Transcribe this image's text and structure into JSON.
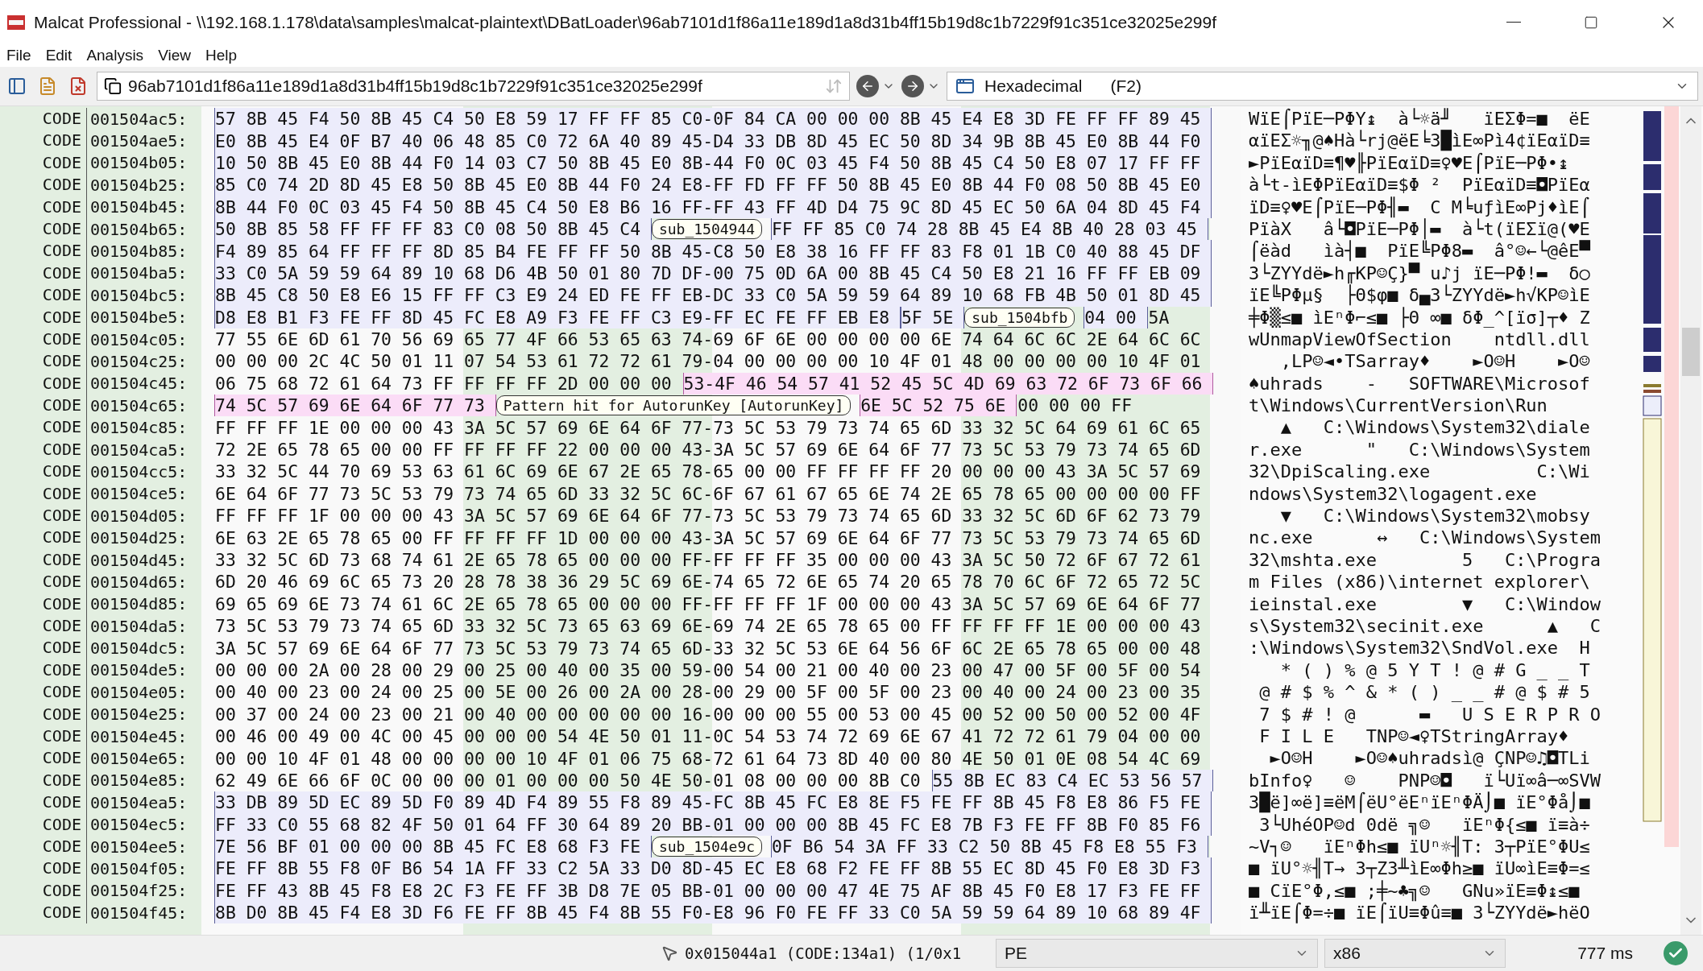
{
  "window": {
    "title": "Malcat Professional - \\\\192.168.1.178\\data\\samples\\malcat-plaintext\\DBatLoader\\96ab7101d1f86a11e189d1a8d31b4ff15b19d8c1b7229f91c351ce32025e299f"
  },
  "menu": [
    "File",
    "Edit",
    "Analysis",
    "View",
    "Help"
  ],
  "toolbar": {
    "path": "96ab7101d1f86a11e189d1a8d31b4ff15b19d8c1b7229f91c351ce32025e299f",
    "view_mode": {
      "label": "Hexadecimal",
      "shortcut": "(F2)"
    }
  },
  "hex_view": {
    "rows": [
      {
        "segment": "CODE",
        "address": "001504ac5:",
        "spans": [
          {
            "kind": "function",
            "text": "57 8B 45 F4 50 8B 45 C4 50 E8 59 17 FF FF 85 C0-0F 84 CA 00 00 00 8B 45 E4 E8 3D FE FF FF 89 45"
          }
        ],
        "ascii": "WïE⌠PïE─PΦY↨  à└☼ä╜   ïEΣΦ=■  ëE"
      },
      {
        "segment": "CODE",
        "address": "001504ae5:",
        "spans": [
          {
            "kind": "function",
            "text": "E0 8B 45 E4 0F B7 40 06 48 85 C0 72 6A 40 89 45-D4 33 DB 8D 45 EC 50 8D 34 9B 8B 45 E0 8B 44 F0"
          }
        ],
        "ascii": "αïEΣ☼╖@♠Hà└rj@ëE╘3█ìE∞Pì4¢ïEαïD≡"
      },
      {
        "segment": "CODE",
        "address": "001504b05:",
        "spans": [
          {
            "kind": "function",
            "text": "10 50 8B 45 E0 8B 44 F0 14 03 C7 50 8B 45 E0 8B-44 F0 0C 03 45 F4 50 8B 45 C4 50 E8 07 17 FF FF"
          }
        ],
        "ascii": "►PïEαïD≡¶♥╟PïEαïD≡♀♥E⌠PïE─PΦ•↨  "
      },
      {
        "segment": "CODE",
        "address": "001504b25:",
        "spans": [
          {
            "kind": "function",
            "text": "85 C0 74 2D 8D 45 E8 50 8B 45 E0 8B 44 F0 24 E8-FF FD FF FF 50 8B 45 E0 8B 44 F0 08 50 8B 45 E0"
          }
        ],
        "ascii": "à└t-ìEΦPïEαïD≡$Φ ²  PïEαïD≡◘PïEα"
      },
      {
        "segment": "CODE",
        "address": "001504b45:",
        "spans": [
          {
            "kind": "function",
            "text": "8B 44 F0 0C 03 45 F4 50 8B 45 C4 50 E8 B6 16 FF-FF 43 FF 4D D4 75 9C 8D 45 EC 50 6A 04 8D 45 F4"
          }
        ],
        "ascii": "ïD≡♀♥E⌠PïE─PΦ╢▬  C M╘uƒìE∞Pj♦ìE⌠"
      },
      {
        "segment": "CODE",
        "address": "001504b65:",
        "spans": [
          {
            "kind": "function",
            "text": "50 8B 85 58 FF FF FF 83 C0 08 50 8B 45 C4"
          },
          {
            "kind": "label",
            "text": "sub_1504944"
          },
          {
            "kind": "function",
            "text": "FF FF 85 C0 74 28 8B 45 E4 8B 40 28 03 45"
          }
        ],
        "ascii": "PïàX   â└◘PïE─PΦ│▬  à└t(ïEΣï@(♥E"
      },
      {
        "segment": "CODE",
        "address": "001504b85:",
        "spans": [
          {
            "kind": "function",
            "text": "F4 89 85 64 FF FF FF 8D 85 B4 FE FF FF 50 8B 45-C8 50 E8 38 16 FF FF 83 F8 01 1B C0 40 88 45 DF"
          }
        ],
        "ascii": "⌠ëàd   ìà┤■  PïE╚PΦ8▬  â°☺←└@êE▀"
      },
      {
        "segment": "CODE",
        "address": "001504ba5:",
        "spans": [
          {
            "kind": "function",
            "text": "33 C0 5A 59 59 64 89 10 68 D6 4B 50 01 80 7D DF-00 75 0D 6A 00 8B 45 C4 50 E8 21 16 FF FF EB 09"
          }
        ],
        "ascii": "3└ZYYdë►h╓KP☺Ç}▀ u♪j ïE─PΦ!▬  δ○"
      },
      {
        "segment": "CODE",
        "address": "001504bc5:",
        "spans": [
          {
            "kind": "function",
            "text": "8B 45 C8 50 E8 E6 15 FF FF C3 E9 24 ED FE FF EB-DC 33 C0 5A 59 59 64 89 10 68 FB 4B 50 01 8D 45"
          }
        ],
        "ascii": "ïE╚PΦµ§  ├Θ$φ■ δ▄3└ZYYdë►h√KP☺ìE"
      },
      {
        "segment": "CODE",
        "address": "001504be5:",
        "spans": [
          {
            "kind": "function",
            "text": "D8 E8 B1 F3 FE FF 8D 45 FC E8 A9 F3 FE FF C3 E9-FF EC FE FF EB E8"
          },
          {
            "kind": "function",
            "text": "5F 5E"
          },
          {
            "kind": "label",
            "text": "sub_1504bfb"
          },
          {
            "kind": "function",
            "text": "04 00"
          },
          {
            "kind": "plain",
            "text": "5A"
          }
        ],
        "ascii": "╪Φ▒≤■ ìEⁿΦ⌐≤■ ├Θ ∞■ δΦ_^[ïσ]┬♦ Z"
      },
      {
        "segment": "CODE",
        "address": "001504c05:",
        "spans": [
          {
            "kind": "plain",
            "text": "77 55 6E 6D 61 70 56 69 65 77 4F 66 53 65 63 74-69 6F 6E 00 00 00 00 6E 74 64 6C 6C 2E 64 6C 6C"
          }
        ],
        "ascii": "wUnmapViewOfSection    ntdll.dll"
      },
      {
        "segment": "CODE",
        "address": "001504c25:",
        "spans": [
          {
            "kind": "plain",
            "text": "00 00 00 2C 4C 50 01 11 07 54 53 61 72 72 61 79-04 00 00 00 00 10 4F 01 48 00 00 00 00 10 4F 01"
          }
        ],
        "ascii": "   ,LP☺◄•TSarray♦    ►O☺H    ►O☺"
      },
      {
        "segment": "CODE",
        "address": "001504c45:",
        "spans": [
          {
            "kind": "plain",
            "text": "06 75 68 72 61 64 73 FF FF FF FF 2D 00 00 00"
          },
          {
            "kind": "pattern",
            "text": "53-4F 46 54 57 41 52 45 5C 4D 69 63 72 6F 73 6F 66"
          }
        ],
        "ascii": "♠uhrads    -   SOFTWARE\\Microsof"
      },
      {
        "segment": "CODE",
        "address": "001504c65:",
        "spans": [
          {
            "kind": "pattern",
            "text": "74 5C 57 69 6E 64 6F 77 73"
          },
          {
            "kind": "label",
            "text": "Pattern hit for AutorunKey [AutorunKey]"
          },
          {
            "kind": "pattern",
            "text": "6E 5C 52 75 6E"
          },
          {
            "kind": "plain",
            "text": "00 00 00 FF"
          }
        ],
        "ascii": "t\\Windows\\CurrentVersion\\Run"
      },
      {
        "segment": "CODE",
        "address": "001504c85:",
        "spans": [
          {
            "kind": "plain",
            "text": "FF FF FF 1E 00 00 00 43 3A 5C 57 69 6E 64 6F 77-73 5C 53 79 73 74 65 6D 33 32 5C 64 69 61 6C 65"
          }
        ],
        "ascii": "   ▲   C:\\Windows\\System32\\diale"
      },
      {
        "segment": "CODE",
        "address": "001504ca5:",
        "spans": [
          {
            "kind": "plain",
            "text": "72 2E 65 78 65 00 00 FF FF FF FF 22 00 00 00 43-3A 5C 57 69 6E 64 6F 77 73 5C 53 79 73 74 65 6D"
          }
        ],
        "ascii": "r.exe      \"   C:\\Windows\\System"
      },
      {
        "segment": "CODE",
        "address": "001504cc5:",
        "spans": [
          {
            "kind": "plain",
            "text": "33 32 5C 44 70 69 53 63 61 6C 69 6E 67 2E 65 78-65 00 00 FF FF FF FF 20 00 00 00 43 3A 5C 57 69"
          }
        ],
        "ascii": "32\\DpiScaling.exe          C:\\Wi"
      },
      {
        "segment": "CODE",
        "address": "001504ce5:",
        "spans": [
          {
            "kind": "plain",
            "text": "6E 64 6F 77 73 5C 53 79 73 74 65 6D 33 32 5C 6C-6F 67 61 67 65 6E 74 2E 65 78 65 00 00 00 00 FF"
          }
        ],
        "ascii": "ndows\\System32\\logagent.exe"
      },
      {
        "segment": "CODE",
        "address": "001504d05:",
        "spans": [
          {
            "kind": "plain",
            "text": "FF FF FF 1F 00 00 00 43 3A 5C 57 69 6E 64 6F 77-73 5C 53 79 73 74 65 6D 33 32 5C 6D 6F 62 73 79"
          }
        ],
        "ascii": "   ▼   C:\\Windows\\System32\\mobsy"
      },
      {
        "segment": "CODE",
        "address": "001504d25:",
        "spans": [
          {
            "kind": "plain",
            "text": "6E 63 2E 65 78 65 00 FF FF FF FF 1D 00 00 00 43-3A 5C 57 69 6E 64 6F 77 73 5C 53 79 73 74 65 6D"
          }
        ],
        "ascii": "nc.exe      ↔   C:\\Windows\\System"
      },
      {
        "segment": "CODE",
        "address": "001504d45:",
        "spans": [
          {
            "kind": "plain",
            "text": "33 32 5C 6D 73 68 74 61 2E 65 78 65 00 00 00 FF-FF FF FF 35 00 00 00 43 3A 5C 50 72 6F 67 72 61"
          }
        ],
        "ascii": "32\\mshta.exe        5   C:\\Progra"
      },
      {
        "segment": "CODE",
        "address": "001504d65:",
        "spans": [
          {
            "kind": "plain",
            "text": "6D 20 46 69 6C 65 73 20 28 78 38 36 29 5C 69 6E-74 65 72 6E 65 74 20 65 78 70 6C 6F 72 65 72 5C"
          }
        ],
        "ascii": "m Files (x86)\\internet explorer\\"
      },
      {
        "segment": "CODE",
        "address": "001504d85:",
        "spans": [
          {
            "kind": "plain",
            "text": "69 65 69 6E 73 74 61 6C 2E 65 78 65 00 00 00 FF-FF FF FF 1F 00 00 00 43 3A 5C 57 69 6E 64 6F 77"
          }
        ],
        "ascii": "ieinstal.exe        ▼   C:\\Window"
      },
      {
        "segment": "CODE",
        "address": "001504da5:",
        "spans": [
          {
            "kind": "plain",
            "text": "73 5C 53 79 73 74 65 6D 33 32 5C 73 65 63 69 6E-69 74 2E 65 78 65 00 FF FF FF FF 1E 00 00 00 43"
          }
        ],
        "ascii": "s\\System32\\secinit.exe      ▲   C"
      },
      {
        "segment": "CODE",
        "address": "001504dc5:",
        "spans": [
          {
            "kind": "plain",
            "text": "3A 5C 57 69 6E 64 6F 77 73 5C 53 79 73 74 65 6D-33 32 5C 53 6E 64 56 6F 6C 2E 65 78 65 00 00 48"
          }
        ],
        "ascii": ":\\Windows\\System32\\SndVol.exe  H"
      },
      {
        "segment": "CODE",
        "address": "001504de5:",
        "spans": [
          {
            "kind": "plain",
            "text": "00 00 00 2A 00 28 00 29 00 25 00 40 00 35 00 59-00 54 00 21 00 40 00 23 00 47 00 5F 00 5F 00 54"
          }
        ],
        "ascii": "   * ( ) % @ 5 Y T ! @ # G _ _ T"
      },
      {
        "segment": "CODE",
        "address": "001504e05:",
        "spans": [
          {
            "kind": "plain",
            "text": "00 40 00 23 00 24 00 25 00 5E 00 26 00 2A 00 28-00 29 00 5F 00 5F 00 23 00 40 00 24 00 23 00 35"
          }
        ],
        "ascii": " @ # $ % ^ & * ( ) _ _ # @ $ # 5"
      },
      {
        "segment": "CODE",
        "address": "001504e25:",
        "spans": [
          {
            "kind": "plain",
            "text": "00 37 00 24 00 23 00 21 00 40 00 00 00 00 00 16-00 00 00 55 00 53 00 45 00 52 00 50 00 52 00 4F"
          }
        ],
        "ascii": " 7 $ # ! @      ▬   U S E R P R O"
      },
      {
        "segment": "CODE",
        "address": "001504e45:",
        "spans": [
          {
            "kind": "plain",
            "text": "00 46 00 49 00 4C 00 45 00 00 00 54 4E 50 01 11-0C 54 53 74 72 69 6E 67 41 72 72 61 79 04 00 00"
          }
        ],
        "ascii": " F I L E   TNP☺◄♀TStringArray♦"
      },
      {
        "segment": "CODE",
        "address": "001504e65:",
        "spans": [
          {
            "kind": "plain",
            "text": "00 00 10 4F 01 48 00 00 00 00 10 4F 01 06 75 68-72 61 64 73 8D 40 00 80 4E 50 01 0E 08 54 4C 69"
          }
        ],
        "ascii": "  ►O☺H    ►O☺♠uhradsì@ ÇNP☺♫◘TLi"
      },
      {
        "segment": "CODE",
        "address": "001504e85:",
        "spans": [
          {
            "kind": "plain",
            "text": "62 49 6E 66 6F 0C 00 00 00 01 00 00 00 50 4E 50-01 08 00 00 00 8B C0"
          },
          {
            "kind": "function",
            "text": "55 8B EC 83 C4 EC 53 56 57"
          }
        ],
        "ascii": "bInfo♀   ☺    PNP☺◘   ï└Uï∞â─∞SVW"
      },
      {
        "segment": "CODE",
        "address": "001504ea5:",
        "spans": [
          {
            "kind": "function",
            "text": "33 DB 89 5D EC 89 5D F0 89 4D F4 89 55 F8 89 45-FC 8B 45 FC E8 8E F5 FE FF 8B 45 F8 E8 86 F5 FE"
          }
        ],
        "ascii": "3█ë]∞ë]≡ëM⌠ëU°ëEⁿïEⁿΦÄ⌡■ ïE°Φå⌡■"
      },
      {
        "segment": "CODE",
        "address": "001504ec5:",
        "spans": [
          {
            "kind": "function",
            "text": "FF 33 C0 55 68 82 4F 50 01 64 FF 30 64 89 20 BB-01 00 00 00 8B 45 FC E8 7B F3 FE FF 8B F0 85 F6"
          }
        ],
        "ascii": " 3└UhéOP☺d 0dë ╗☺   ïEⁿΦ{≤■ ï≡à÷"
      },
      {
        "segment": "CODE",
        "address": "001504ee5:",
        "spans": [
          {
            "kind": "function",
            "text": "7E 56 BF 01 00 00 00 8B 45 FC E8 68 F3 FE"
          },
          {
            "kind": "label",
            "text": "sub_1504e9c"
          },
          {
            "kind": "function",
            "text": "0F B6 54 3A FF 33 C2 50 8B 45 F8 E8 55 F3"
          }
        ],
        "ascii": "~V┐☺   ïEⁿΦh≤■ ïUⁿ☼╢T: 3┬PïE°ΦU≤"
      },
      {
        "segment": "CODE",
        "address": "001504f05:",
        "spans": [
          {
            "kind": "function",
            "text": "FE FF 8B 55 F8 0F B6 54 1A FF 33 C2 5A 33 D0 8D-45 EC E8 68 F2 FE FF 8B 55 EC 8D 45 F0 E8 3D F3"
          }
        ],
        "ascii": "■ ïU°☼╢T→ 3┬Z3╨ìE∞Φh≥■ ïU∞ìE≡Φ=≤"
      },
      {
        "segment": "CODE",
        "address": "001504f25:",
        "spans": [
          {
            "kind": "function",
            "text": "FE FF 43 8B 45 F8 E8 2C F3 FE FF 3B D8 7E 05 BB-01 00 00 00 47 4E 75 AF 8B 45 F0 E8 17 F3 FE FF"
          }
        ],
        "ascii": "■ CïE°Φ,≤■ ;╪~♣╗☺   GNu»ïE≡Φ↨≤■"
      },
      {
        "segment": "CODE",
        "address": "001504f45:",
        "spans": [
          {
            "kind": "function",
            "text": "8B D0 8B 45 F4 E8 3D F6 FE FF 8B 45 F4 8B 55 F0-E8 96 F0 FE FF 33 C0 5A 59 59 64 89 10 68 89 4F"
          }
        ],
        "ascii": "ï╨ïE⌠Φ=÷■ ïE⌠ïU≡Φû≡■ 3└ZYYdë►hëO"
      }
    ]
  },
  "status_bar": {
    "position": "0x015044a1 (CODE:134a1) (1/0x1",
    "format": "PE",
    "architecture": "x86",
    "timing": "777 ms"
  }
}
